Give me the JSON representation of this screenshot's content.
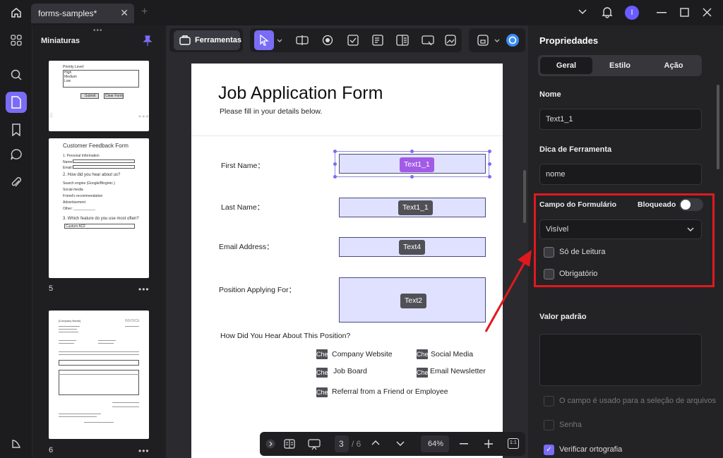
{
  "titlebar": {
    "tab_label": "forms-samples*",
    "close_glyph": "✕",
    "add_glyph": "+"
  },
  "thumbnails": {
    "title": "Miniaturas",
    "pages": [
      {
        "number": "4",
        "mini": {
          "priority": "Priority Level:",
          "opts": [
            "High",
            "Medium",
            "Low"
          ],
          "submit": "Submit",
          "clear": "Clear Form"
        }
      },
      {
        "number": "5",
        "mini": {
          "title": "Customer Feedback Form",
          "s1": "1. Personal Information",
          "name": "Name:",
          "email": "Email:",
          "s2": "2. How did you hear about us?",
          "opts": [
            "Search engine (Google/Bing/etc.)",
            "Social media",
            "Friend's recommendation",
            "Advertisement",
            "Other: ___________"
          ],
          "s3": "3. Which feature do you use most often?",
          "dropdown": "Custom ACF"
        }
      },
      {
        "number": "6",
        "mini": {
          "company": "[Company Name]",
          "invoice": "INVOICE"
        }
      }
    ],
    "more_glyph": "•••"
  },
  "toolbar": {
    "ferramentas_label": "Ferramentas"
  },
  "document": {
    "title": "Job Application Form",
    "subtitle": "Please fill in your details below.",
    "fields": [
      {
        "label": "First Name：",
        "tag": "Text1_1"
      },
      {
        "label": "Last Name：",
        "tag": "Text1_1"
      },
      {
        "label": "Email Address：",
        "tag": "Text4"
      },
      {
        "label": "Position Applying For：",
        "tag": "Text2"
      }
    ],
    "question": "How Did You Hear About This Position?",
    "checkbox_tag": "Check Box",
    "options": [
      "Company Website",
      "Social Media",
      "Job Board",
      "Email Newsletter",
      "Referral from a Friend or Employee"
    ]
  },
  "bottom_bar": {
    "page_current": "3",
    "page_total": "/ 6",
    "zoom": "64%",
    "fit_label": "1:1"
  },
  "properties": {
    "title": "Propriedades",
    "tabs": [
      "Geral",
      "Estilo",
      "Ação"
    ],
    "name_label": "Nome",
    "name_value": "Text1_1",
    "tooltip_label": "Dica de Ferramenta",
    "tooltip_value": "nome",
    "form_field_label": "Campo do Formulário",
    "locked_label": "Bloqueado",
    "visibility_value": "Visível",
    "readonly_label": "Só de Leitura",
    "required_label": "Obrigatório",
    "default_value_label": "Valor padrão",
    "file_select_label": "O campo é usado para a seleção de arquivos",
    "password_label": "Senha",
    "spellcheck_label": "Verificar ortografia"
  },
  "colors": {
    "accent": "#7b6cf6",
    "highlight": "#e0191e",
    "field_fill": "#dfe1ff"
  }
}
